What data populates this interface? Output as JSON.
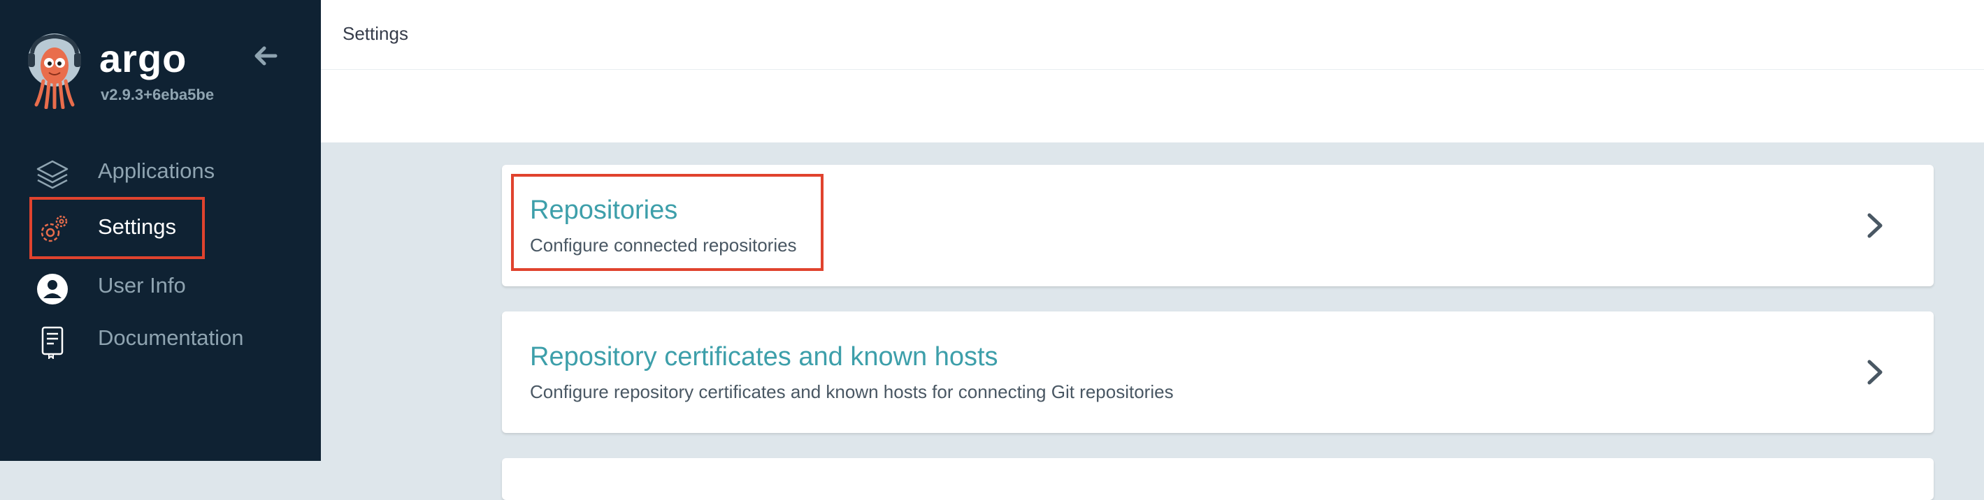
{
  "app": {
    "name": "argo",
    "version": "v2.9.3+6eba5be"
  },
  "sidebar": {
    "items": [
      {
        "label": "Applications",
        "icon": "layers-icon",
        "active": false
      },
      {
        "label": "Settings",
        "icon": "gear-icon",
        "active": true
      },
      {
        "label": "User Info",
        "icon": "user-circle-icon",
        "active": false
      },
      {
        "label": "Documentation",
        "icon": "book-icon",
        "active": false
      }
    ]
  },
  "header": {
    "title": "Settings"
  },
  "settings_cards": [
    {
      "title": "Repositories",
      "description": "Configure connected repositories"
    },
    {
      "title": "Repository certificates and known hosts",
      "description": "Configure repository certificates and known hosts for connecting Git repositories"
    }
  ],
  "colors": {
    "sidebar_bg": "#0f2233",
    "accent_teal": "#3d9faa",
    "highlight_red": "#e0432e",
    "content_bg": "#dee6eb",
    "logo_orange": "#e96d4c"
  }
}
